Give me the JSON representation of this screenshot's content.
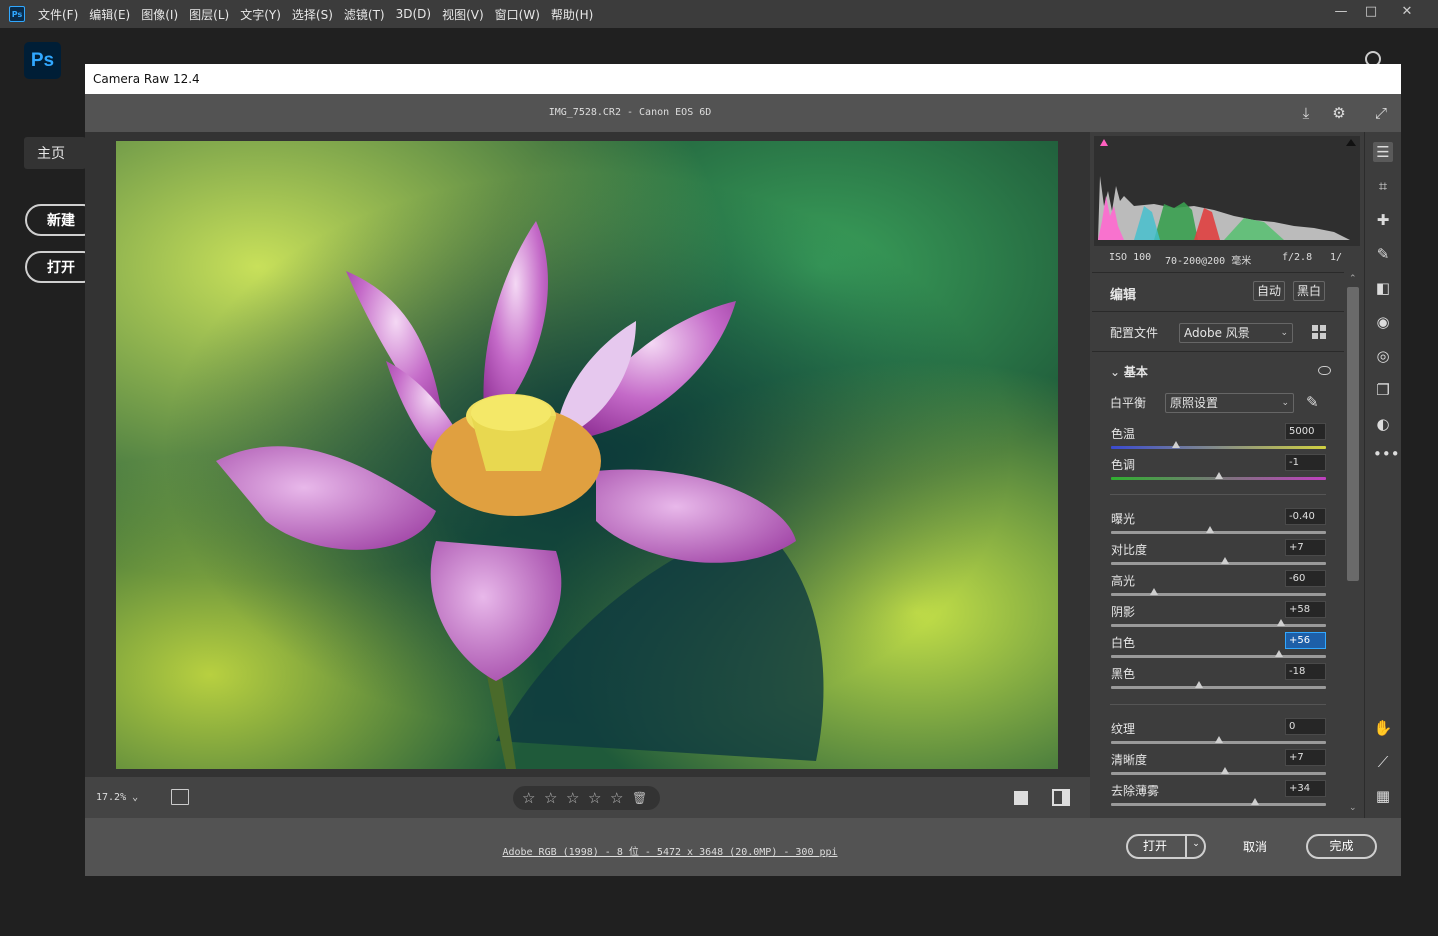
{
  "ps": {
    "logo": "Ps",
    "mini_logo": "Ps",
    "menu": [
      "文件(F)",
      "编辑(E)",
      "图像(I)",
      "图层(L)",
      "文字(Y)",
      "选择(S)",
      "滤镜(T)",
      "3D(D)",
      "视图(V)",
      "窗口(W)",
      "帮助(H)"
    ],
    "home_label": "主页",
    "new_label": "新建",
    "open_label": "打开",
    "window_controls": [
      "—",
      "□",
      "✕"
    ]
  },
  "camera_raw": {
    "title": "Camera Raw 12.4",
    "filename": "IMG_7528.CR2 -  Canon EOS 6D",
    "camera_info": {
      "iso": "ISO 100",
      "lens": "70-200@200 毫米",
      "aperture": "f/2.8",
      "shutter": "1/"
    },
    "edit_label": "编辑",
    "auto_label": "自动",
    "bw_label": "黑白",
    "profile_label": "配置文件",
    "profile_value": "Adobe 风景",
    "basic_label": "基本",
    "wb_label": "白平衡",
    "wb_value": "原照设置",
    "sliders": [
      {
        "label": "色温",
        "value": "5000",
        "pos": 0.3,
        "track": "temp"
      },
      {
        "label": "色调",
        "value": "-1",
        "pos": 0.5,
        "track": "tint"
      },
      {
        "label": "曝光",
        "value": "-0.40",
        "pos": 0.46
      },
      {
        "label": "对比度",
        "value": "+7",
        "pos": 0.53
      },
      {
        "label": "高光",
        "value": "-60",
        "pos": 0.2
      },
      {
        "label": "阴影",
        "value": "+58",
        "pos": 0.79
      },
      {
        "label": "白色",
        "value": "+56",
        "pos": 0.78,
        "active": true
      },
      {
        "label": "黑色",
        "value": "-18",
        "pos": 0.41
      },
      {
        "label": "纹理",
        "value": "0",
        "pos": 0.5
      },
      {
        "label": "清晰度",
        "value": "+7",
        "pos": 0.53
      },
      {
        "label": "去除薄雾",
        "value": "+34",
        "pos": 0.67
      }
    ],
    "zoom": "17.2%",
    "stars": [
      "☆",
      "☆",
      "☆",
      "☆",
      "☆"
    ],
    "footer_info": "Adobe RGB (1998) - 8 位 - 5472 x 3648 (20.0MP) - 300 ppi",
    "open_btn": "打开",
    "cancel_btn": "取消",
    "done_btn": "完成",
    "colors": {
      "accent": "#31a8ff",
      "panel": "#3d3d3d",
      "dark": "#535353"
    }
  }
}
